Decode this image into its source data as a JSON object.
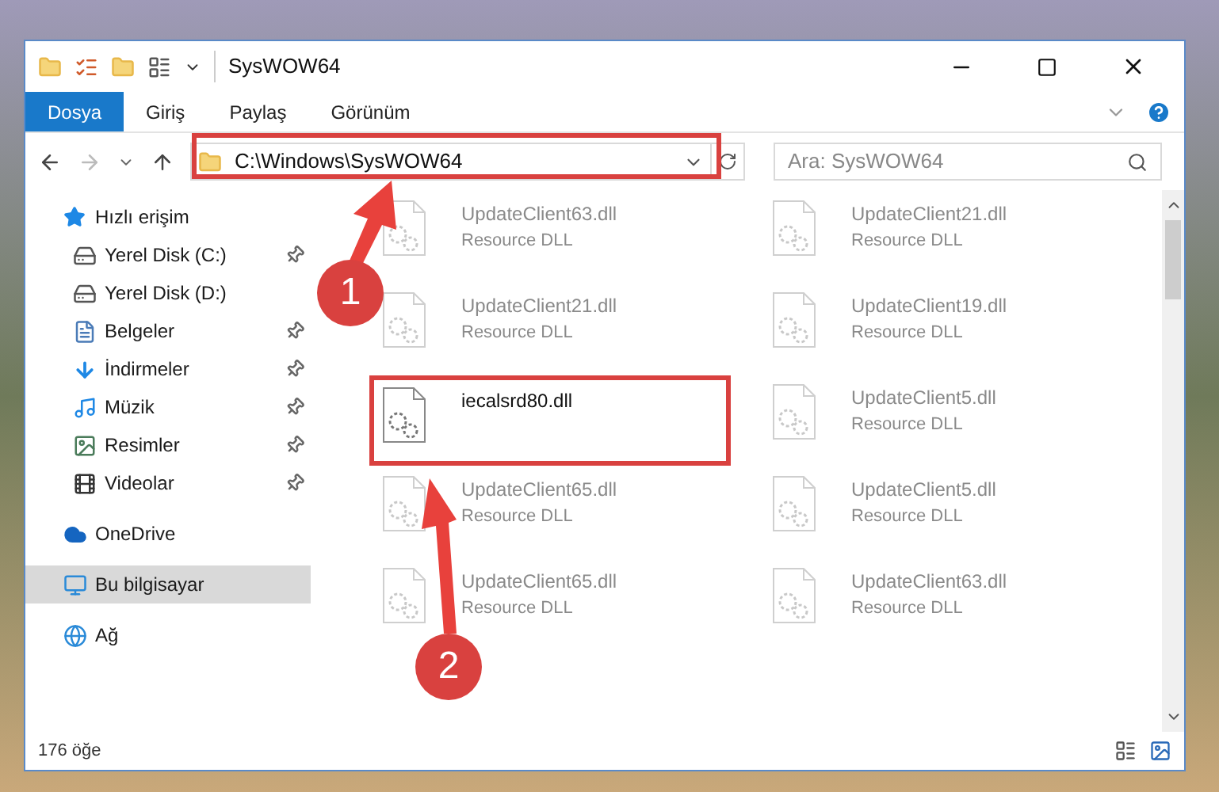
{
  "window": {
    "title": "SysWOW64"
  },
  "ribbon_tabs": [
    {
      "label": "Dosya",
      "selected": true
    },
    {
      "label": "Giriş",
      "selected": false
    },
    {
      "label": "Paylaş",
      "selected": false
    },
    {
      "label": "Görünüm",
      "selected": false
    }
  ],
  "address_bar": {
    "path": "C:\\Windows\\SysWOW64"
  },
  "search": {
    "placeholder": "Ara: SysWOW64"
  },
  "sidebar": {
    "items": [
      {
        "label": "Hızlı erişim",
        "kind": "quick",
        "selected": false,
        "children": [
          {
            "label": "Yerel Disk (C:)",
            "kind": "drive",
            "pinned": true,
            "selected": false
          },
          {
            "label": "Yerel Disk (D:)",
            "kind": "drive",
            "pinned": false,
            "selected": false
          },
          {
            "label": "Belgeler",
            "kind": "documents",
            "pinned": true,
            "selected": false
          },
          {
            "label": "İndirmeler",
            "kind": "downloads",
            "pinned": true,
            "selected": false
          },
          {
            "label": "Müzik",
            "kind": "music",
            "pinned": true,
            "selected": false
          },
          {
            "label": "Resimler",
            "kind": "pictures",
            "pinned": true,
            "selected": false
          },
          {
            "label": "Videolar",
            "kind": "videos",
            "pinned": true,
            "selected": false
          }
        ]
      },
      {
        "label": "OneDrive",
        "kind": "cloud",
        "selected": false
      },
      {
        "label": "Bu bilgisayar",
        "kind": "computer",
        "selected": true
      },
      {
        "label": "Ağ",
        "kind": "network",
        "selected": false
      }
    ]
  },
  "files": [
    {
      "name": "UpdateClient63.dll",
      "type": "Resource DLL",
      "faded": true,
      "highlighted": false
    },
    {
      "name": "UpdateClient21.dll",
      "type": "Resource DLL",
      "faded": true,
      "highlighted": false
    },
    {
      "name": "UpdateClient21.dll",
      "type": "Resource DLL",
      "faded": true,
      "highlighted": false
    },
    {
      "name": "UpdateClient19.dll",
      "type": "Resource DLL",
      "faded": true,
      "highlighted": false
    },
    {
      "name": "iecalsrd80.dll",
      "faded": false,
      "highlighted": true
    },
    {
      "name": "UpdateClient5.dll",
      "type": "Resource DLL",
      "faded": true,
      "highlighted": false
    },
    {
      "name": "UpdateClient65.dll",
      "type": "Resource DLL",
      "faded": true,
      "highlighted": false
    },
    {
      "name": "UpdateClient5.dll",
      "type": "Resource DLL",
      "faded": true,
      "highlighted": false
    },
    {
      "name": "UpdateClient65.dll",
      "type": "Resource DLL",
      "faded": true,
      "highlighted": false
    },
    {
      "name": "UpdateClient63.dll",
      "type": "Resource DLL",
      "faded": true,
      "highlighted": false
    }
  ],
  "status_bar": {
    "item_count": "176 öğe"
  },
  "annotations": [
    {
      "number": "1"
    },
    {
      "number": "2"
    }
  ]
}
